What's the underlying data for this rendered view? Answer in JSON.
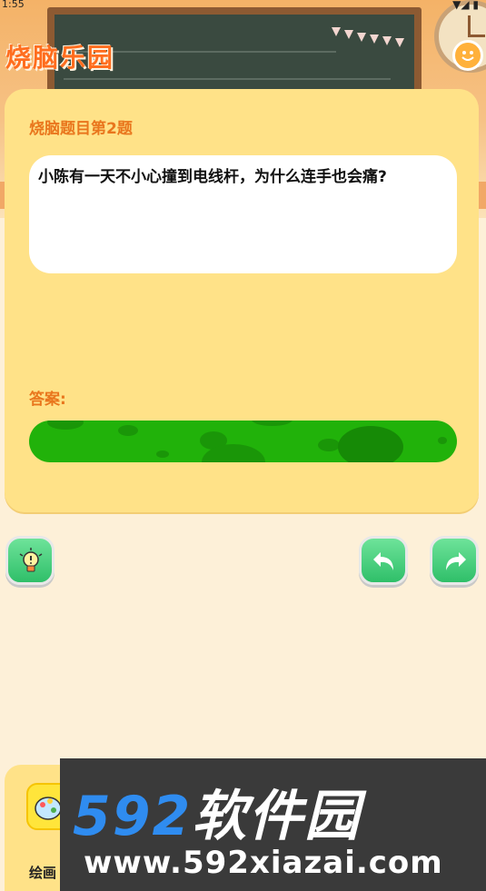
{
  "status": {
    "time": "1:55",
    "icons": "▼◢ ▮"
  },
  "app": {
    "title": "烧脑乐园"
  },
  "question": {
    "title": "烧脑题目第2题",
    "text": "小陈有一天不小心撞到电线杆，为什么连手也会痛?"
  },
  "answer": {
    "label": "答案:"
  },
  "actions": {
    "hint": "lightbulb-icon",
    "prev": "undo-arrow-icon",
    "next": "redo-arrow-icon"
  },
  "bottom_nav": {
    "label": "绘画"
  },
  "watermark": {
    "brand_num": "592",
    "brand_text": "软件园",
    "url": "www.592xiazai.com"
  },
  "colors": {
    "accent": "#e9761d",
    "card": "#ffe288",
    "button": "#3ec576",
    "cover": "#21b20a"
  }
}
